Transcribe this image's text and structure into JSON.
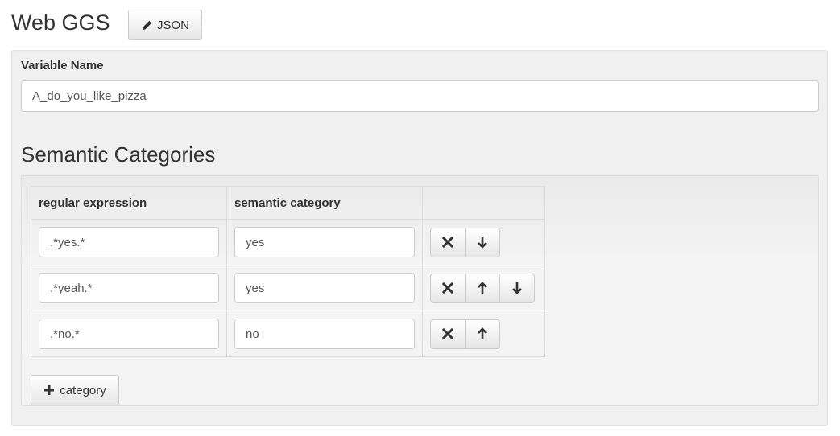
{
  "header": {
    "title": "Web GGS",
    "json_button": {
      "label": "JSON",
      "icon": "pencil-icon"
    }
  },
  "variable": {
    "label": "Variable Name",
    "value": "A_do_you_like_pizza"
  },
  "categories_section": {
    "title": "Semantic Categories",
    "columns": [
      "regular expression",
      "semantic category",
      ""
    ],
    "rows": [
      {
        "regex": ".*yes.*",
        "category": "yes",
        "actions": [
          "remove",
          "move-down"
        ]
      },
      {
        "regex": ".*yeah.*",
        "category": "yes",
        "actions": [
          "remove",
          "move-up",
          "move-down"
        ]
      },
      {
        "regex": ".*no.*",
        "category": "no",
        "actions": [
          "remove",
          "move-up"
        ]
      }
    ],
    "add_button": {
      "label": "category",
      "icon": "plus-icon"
    }
  },
  "icons": {
    "remove": "close-icon",
    "move-up": "arrow-up-icon",
    "move-down": "arrow-down-icon"
  }
}
